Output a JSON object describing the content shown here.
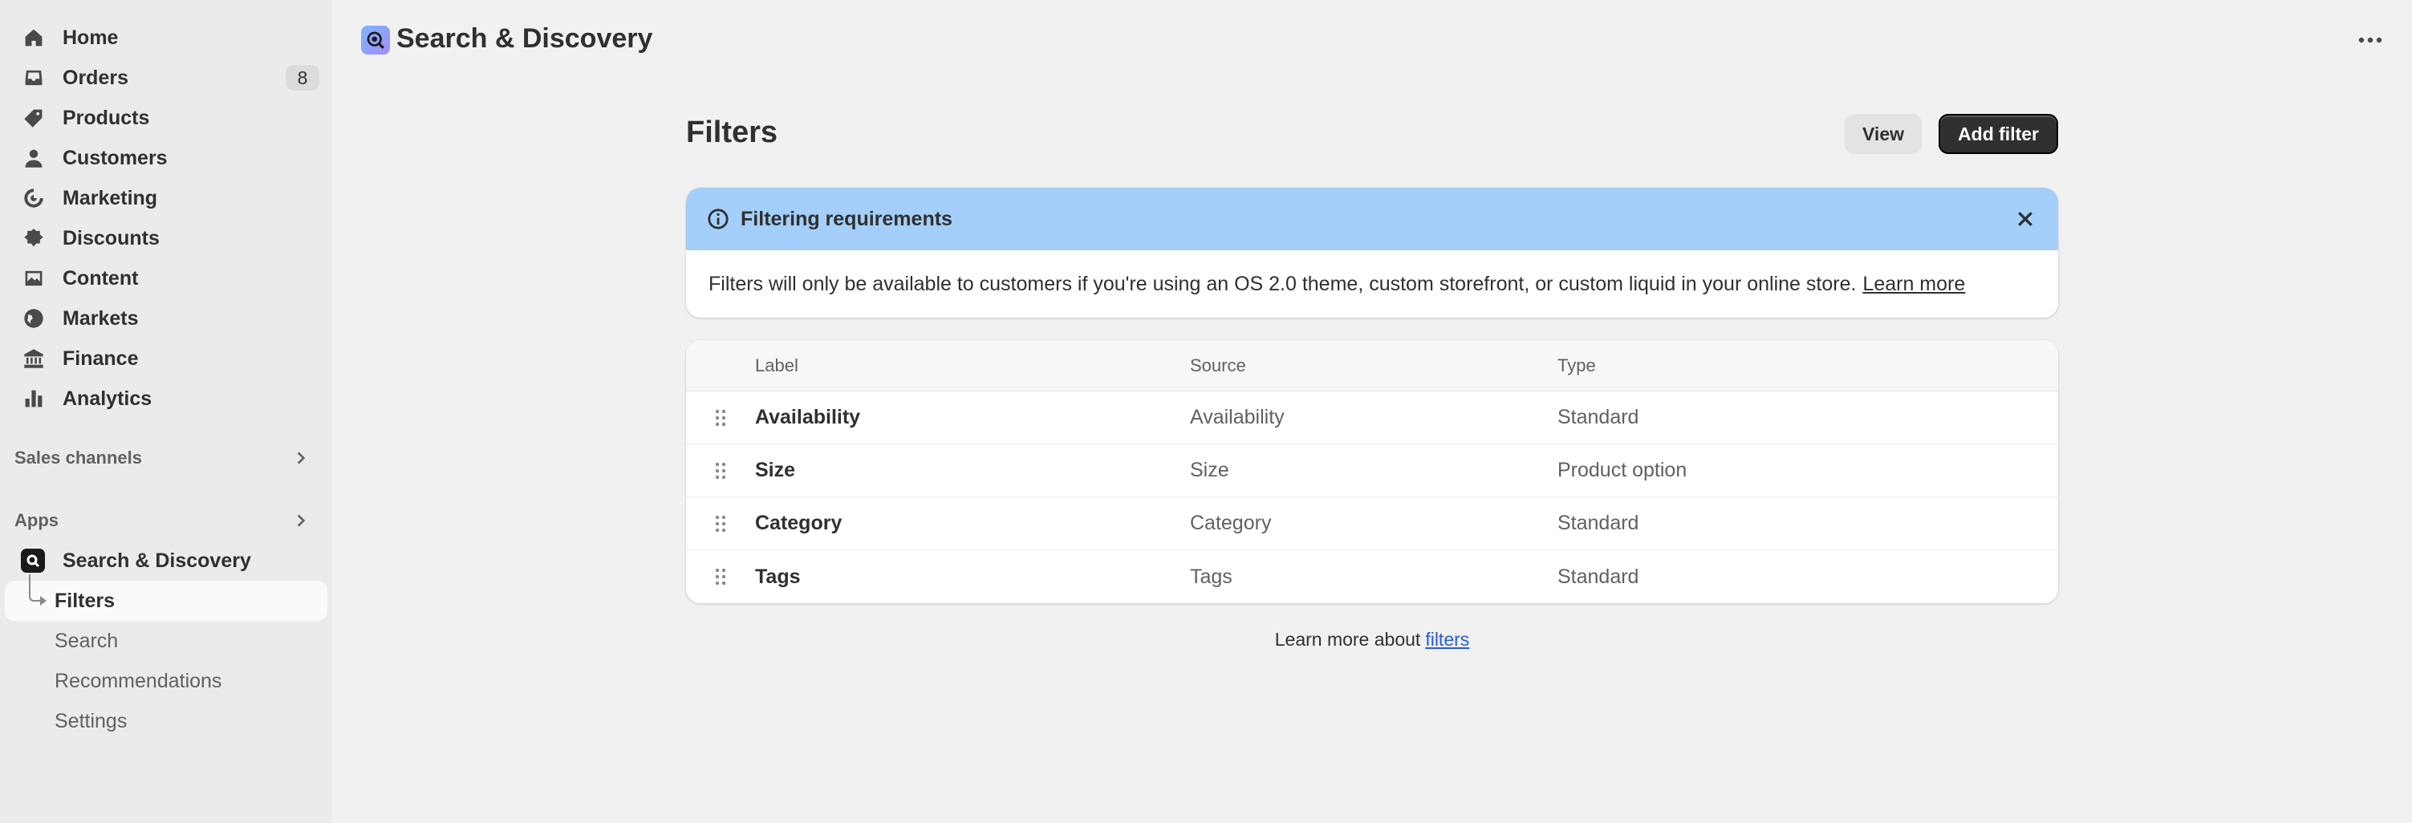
{
  "sidebar": {
    "nav": [
      {
        "label": "Home",
        "icon": "home-icon"
      },
      {
        "label": "Orders",
        "icon": "inbox-icon",
        "badge": "8"
      },
      {
        "label": "Products",
        "icon": "tag-icon"
      },
      {
        "label": "Customers",
        "icon": "person-icon"
      },
      {
        "label": "Marketing",
        "icon": "target-icon"
      },
      {
        "label": "Discounts",
        "icon": "discount-icon"
      },
      {
        "label": "Content",
        "icon": "image-icon"
      },
      {
        "label": "Markets",
        "icon": "globe-icon"
      },
      {
        "label": "Finance",
        "icon": "bank-icon"
      },
      {
        "label": "Analytics",
        "icon": "bar-chart-icon"
      }
    ],
    "sales_channels_label": "Sales channels",
    "apps_label": "Apps",
    "app": {
      "label": "Search & Discovery",
      "icon": "search-discovery-logo-icon"
    },
    "sub_items": [
      {
        "label": "Filters",
        "active": true
      },
      {
        "label": "Search"
      },
      {
        "label": "Recommendations"
      },
      {
        "label": "Settings"
      }
    ]
  },
  "header": {
    "app_title": "Search & Discovery",
    "more_icon": "ellipsis-icon"
  },
  "main": {
    "title": "Filters",
    "view_button": "View",
    "add_button": "Add filter",
    "banner": {
      "title": "Filtering requirements",
      "body": "Filters will only be available to customers if you're using an OS 2.0 theme, custom storefront, or custom liquid in your online store.",
      "link": "Learn more",
      "accent": "#a4cffa"
    },
    "table": {
      "columns": [
        "Label",
        "Source",
        "Type"
      ],
      "rows": [
        {
          "label": "Availability",
          "source": "Availability",
          "type": "Standard"
        },
        {
          "label": "Size",
          "source": "Size",
          "type": "Product option"
        },
        {
          "label": "Category",
          "source": "Category",
          "type": "Standard"
        },
        {
          "label": "Tags",
          "source": "Tags",
          "type": "Standard"
        }
      ]
    },
    "footer": {
      "text": "Learn more about",
      "link": "filters"
    }
  }
}
